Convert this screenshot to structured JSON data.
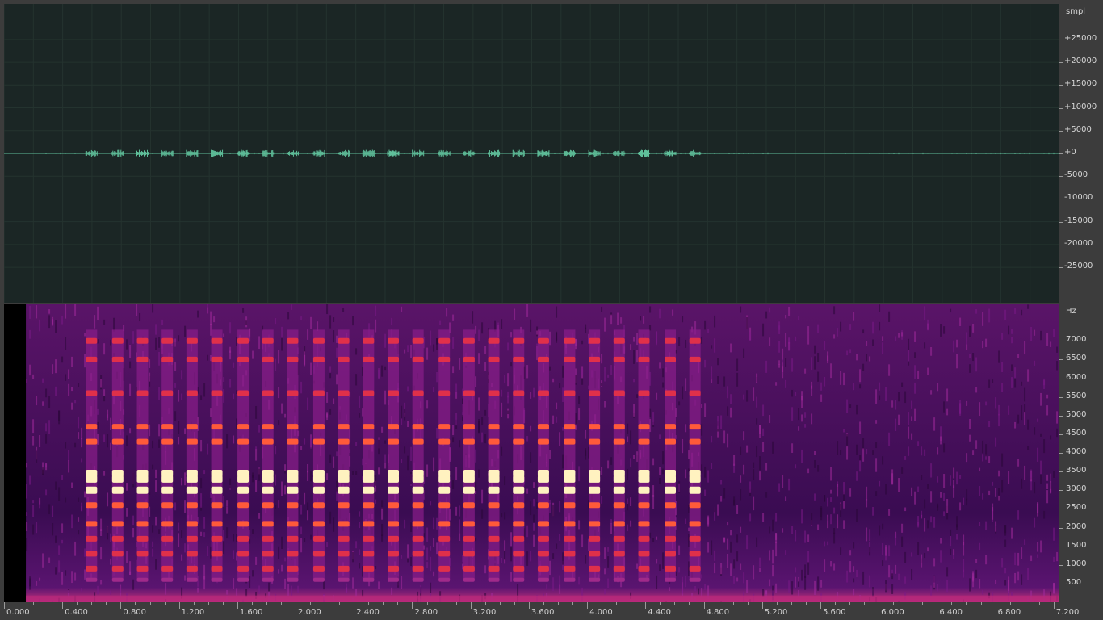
{
  "waveform": {
    "unit": "smpl",
    "axis_labels": [
      "+25000",
      "+20000",
      "+15000",
      "+10000",
      "+5000",
      "+0",
      "-5000",
      "-10000",
      "-15000",
      "-20000",
      "-25000"
    ],
    "axis_values": [
      25000,
      20000,
      15000,
      10000,
      5000,
      0,
      -5000,
      -10000,
      -15000,
      -20000,
      -25000
    ],
    "axis_range": [
      -32768,
      32767
    ],
    "colors": {
      "background": "#1b2625",
      "grid": "#24332f",
      "signal": "#5fbf9a"
    }
  },
  "spectrogram": {
    "unit": "Hz",
    "axis_labels": [
      "7000",
      "6500",
      "6000",
      "5500",
      "5000",
      "4500",
      "4000",
      "3500",
      "3000",
      "2500",
      "2000",
      "1500",
      "1000",
      "500"
    ],
    "axis_values": [
      7000,
      6500,
      6000,
      5500,
      5000,
      4500,
      4000,
      3500,
      3000,
      2500,
      2000,
      1500,
      1000,
      500
    ],
    "axis_range": [
      0,
      8000
    ],
    "bursts_seconds": [
      0.6,
      0.78,
      0.95,
      1.12,
      1.29,
      1.46,
      1.64,
      1.81,
      1.98,
      2.16,
      2.33,
      2.5,
      2.67,
      2.84,
      3.02,
      3.19,
      3.36,
      3.53,
      3.7,
      3.88,
      4.05,
      4.22,
      4.39,
      4.57,
      4.74
    ],
    "colors": {
      "background": "#17081f",
      "noise": "#6a1a78",
      "hot": "#ff3a3a",
      "peak": "#fff2c0"
    }
  },
  "time_axis": {
    "labels": [
      "0.000",
      "0.400",
      "0.800",
      "1.200",
      "1.600",
      "2.000",
      "2.400",
      "2.800",
      "3.200",
      "3.600",
      "4.000",
      "4.400",
      "4.800",
      "5.200",
      "5.600",
      "6.000",
      "6.400",
      "6.800",
      "7.200"
    ],
    "values": [
      0,
      0.4,
      0.8,
      1.2,
      1.6,
      2.0,
      2.4,
      2.8,
      3.2,
      3.6,
      4.0,
      4.4,
      4.8,
      5.2,
      5.6,
      6.0,
      6.4,
      6.8,
      7.2
    ],
    "range_seconds": [
      0,
      7.24
    ]
  }
}
